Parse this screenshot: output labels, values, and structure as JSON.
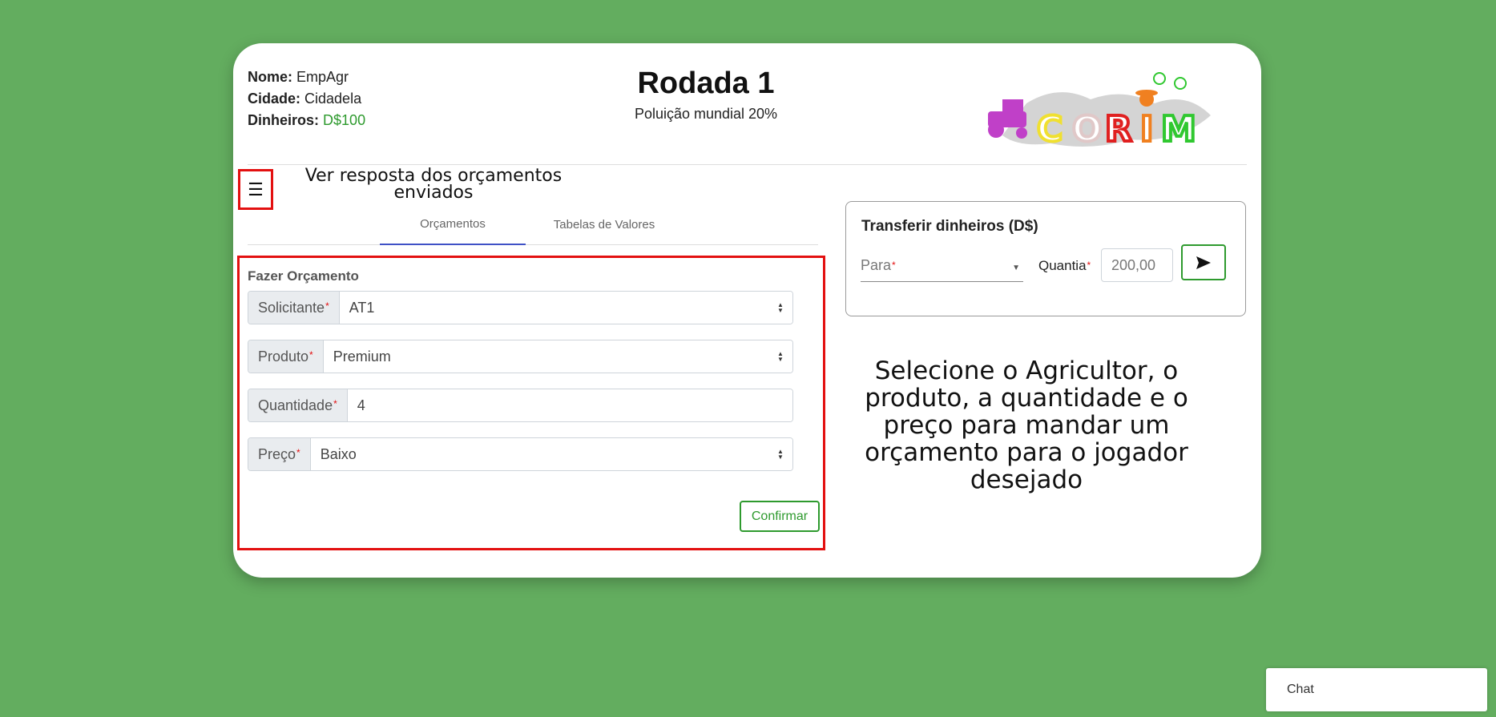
{
  "player": {
    "name_label": "Nome:",
    "name_value": "EmpAgr",
    "city_label": "Cidade:",
    "city_value": "Cidadela",
    "money_label": "Dinheiros:",
    "money_value": "D$100"
  },
  "round": {
    "title": "Rodada 1",
    "pollution": "Poluição mundial 20%"
  },
  "logo": {
    "letters": [
      "C",
      "O",
      "R",
      "I",
      "M"
    ],
    "icon": "tractor-farmer-logo"
  },
  "menu": {
    "icon": "hamburger-menu-icon",
    "glyph": "☰"
  },
  "hint_top": {
    "line1": "Ver resposta dos orçamentos",
    "line2": "enviados"
  },
  "tabs": [
    {
      "label": "Orçamentos",
      "active": true
    },
    {
      "label": "Tabelas de Valores",
      "active": false
    }
  ],
  "order": {
    "title": "Fazer Orçamento",
    "fields": [
      {
        "label": "Solicitante",
        "value": "AT1",
        "type": "select"
      },
      {
        "label": "Produto",
        "value": "Premium",
        "type": "select"
      },
      {
        "label": "Quantidade",
        "value": "4",
        "type": "input"
      },
      {
        "label": "Preço",
        "value": "Baixo",
        "type": "select"
      }
    ],
    "required_mark": "*",
    "confirm_label": "Confirmar"
  },
  "transfer": {
    "title": "Transferir dinheiros (D$)",
    "to_placeholder": "Para",
    "amount_label": "Quantia",
    "amount_placeholder": "200,00",
    "send_icon": "send-arrow-icon"
  },
  "hint_right": {
    "lines": [
      "Selecione o Agricultor, o",
      "produto, a quantidade e o",
      "preço para mandar um",
      "orçamento para o jogador",
      "desejado"
    ]
  },
  "chat": {
    "label": "Chat"
  },
  "colors": {
    "background": "#63ad5f",
    "highlight": "#e31010",
    "accent_green": "#2e9a2e",
    "tab_underline": "#3f51c6"
  }
}
